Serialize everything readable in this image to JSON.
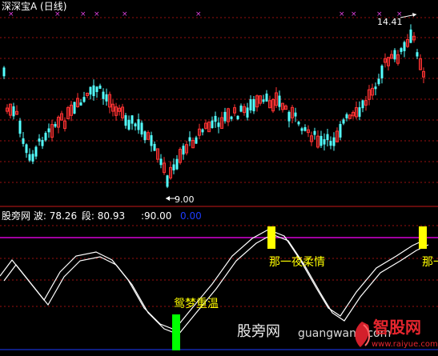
{
  "window": {
    "title": "深深宝A",
    "period": "(日线)"
  },
  "price_pane": {
    "high_label": "14.41",
    "low_label": "9.00",
    "colors": {
      "up": "#ff3232",
      "down": "#54ffff",
      "grid": "#9b1010"
    }
  },
  "indicator_pane": {
    "name": "股旁网",
    "wave_label": "波:",
    "wave_value": "78.26",
    "segment_label": "段:",
    "segment_value": "80.93",
    "level_value": ":90.00",
    "zero_value": "0.00",
    "colors": {
      "line": "#ffffff",
      "level": "#ff00ff",
      "signal_top": "#ffff00",
      "signal_bottom": "#00ff00",
      "blue": "#1e3cff"
    }
  },
  "annotations": {
    "bottom_signal": "鸳梦重温",
    "top_signal_1": "那一夜柔情",
    "top_signal_2": "那一"
  },
  "watermark": {
    "site_name": "股旁网",
    "site_url": "guangwang.com",
    "logo_text": "智股网",
    "logo_url": "www.raiyue.com"
  }
}
